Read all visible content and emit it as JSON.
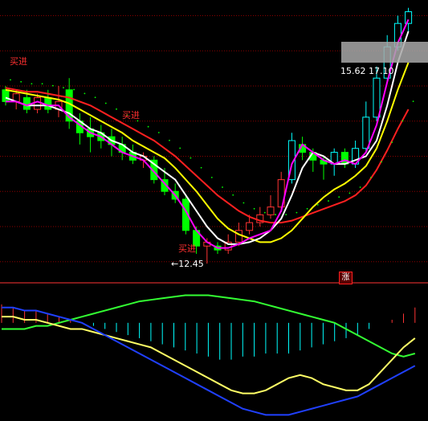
{
  "chart_data": {
    "type": "candlestick",
    "annotations": {
      "low_label": "←12.45",
      "price_label": "15.62  17.10",
      "signals": [
        "买进",
        "买进",
        "买进"
      ],
      "marker": "涨"
    },
    "colors": {
      "background": "#000000",
      "up": "#ff3333",
      "down": "#00ff00",
      "up_alt": "#00ffff",
      "ma_white": "#ffffff",
      "ma_yellow": "#ffff00",
      "ma_red": "#ff2020",
      "ma_magenta": "#ff00ff",
      "macd_dif": "#ffff66",
      "macd_dea": "#2040ff",
      "macd_slow": "#33ff33",
      "grid": "#8b0000"
    },
    "candles": [
      {
        "o": 16.9,
        "c": 16.6,
        "h": 17.0,
        "l": 16.5
      },
      {
        "o": 16.6,
        "c": 16.8,
        "h": 16.9,
        "l": 16.4
      },
      {
        "o": 16.7,
        "c": 16.4,
        "h": 16.9,
        "l": 16.3
      },
      {
        "o": 16.4,
        "c": 16.7,
        "h": 16.8,
        "l": 16.3
      },
      {
        "o": 16.7,
        "c": 16.4,
        "h": 16.9,
        "l": 16.3
      },
      {
        "o": 16.4,
        "c": 16.6,
        "h": 17.0,
        "l": 16.2
      },
      {
        "o": 16.9,
        "c": 16.1,
        "h": 17.2,
        "l": 15.9
      },
      {
        "o": 16.1,
        "c": 15.8,
        "h": 16.3,
        "l": 15.5
      },
      {
        "o": 15.9,
        "c": 15.7,
        "h": 16.2,
        "l": 15.3
      },
      {
        "o": 15.8,
        "c": 15.6,
        "h": 16.0,
        "l": 15.4
      },
      {
        "o": 15.7,
        "c": 15.5,
        "h": 15.9,
        "l": 15.2
      },
      {
        "o": 15.5,
        "c": 15.3,
        "h": 15.7,
        "l": 15.1
      },
      {
        "o": 15.3,
        "c": 15.1,
        "h": 15.5,
        "l": 15.0
      },
      {
        "o": 15.1,
        "c": 15.2,
        "h": 15.3,
        "l": 14.9
      },
      {
        "o": 15.1,
        "c": 14.6,
        "h": 15.2,
        "l": 14.5
      },
      {
        "o": 14.6,
        "c": 14.3,
        "h": 14.9,
        "l": 14.2
      },
      {
        "o": 14.3,
        "c": 14.1,
        "h": 14.5,
        "l": 14.0
      },
      {
        "o": 14.1,
        "c": 13.3,
        "h": 14.2,
        "l": 13.2
      },
      {
        "o": 13.3,
        "c": 12.9,
        "h": 13.4,
        "l": 12.7
      },
      {
        "o": 12.9,
        "c": 13.0,
        "h": 13.1,
        "l": 12.45
      },
      {
        "o": 12.9,
        "c": 12.8,
        "h": 13.0,
        "l": 12.7
      },
      {
        "o": 12.8,
        "c": 13.0,
        "h": 13.2,
        "l": 12.7
      },
      {
        "o": 13.0,
        "c": 13.3,
        "h": 13.5,
        "l": 12.9
      },
      {
        "o": 13.3,
        "c": 13.5,
        "h": 13.7,
        "l": 13.2
      },
      {
        "o": 13.5,
        "c": 13.7,
        "h": 13.9,
        "l": 13.4
      },
      {
        "o": 13.7,
        "c": 13.9,
        "h": 14.2,
        "l": 13.6
      },
      {
        "o": 13.9,
        "c": 14.6,
        "h": 14.8,
        "l": 13.8
      },
      {
        "o": 14.6,
        "c": 15.6,
        "h": 15.8,
        "l": 14.5
      },
      {
        "o": 15.5,
        "c": 15.3,
        "h": 15.7,
        "l": 15.1
      },
      {
        "o": 15.3,
        "c": 15.1,
        "h": 15.4,
        "l": 14.8
      },
      {
        "o": 15.1,
        "c": 15.0,
        "h": 15.2,
        "l": 14.6
      },
      {
        "o": 15.0,
        "c": 15.3,
        "h": 15.4,
        "l": 14.7
      },
      {
        "o": 15.3,
        "c": 15.0,
        "h": 15.4,
        "l": 14.9
      },
      {
        "o": 15.0,
        "c": 15.4,
        "h": 15.6,
        "l": 14.9
      },
      {
        "o": 15.4,
        "c": 16.2,
        "h": 16.6,
        "l": 15.3
      },
      {
        "o": 16.2,
        "c": 17.2,
        "h": 17.5,
        "l": 16.1
      },
      {
        "o": 17.2,
        "c": 18.0,
        "h": 18.3,
        "l": 17.1
      },
      {
        "o": 18.0,
        "c": 18.6,
        "h": 18.8,
        "l": 17.9
      },
      {
        "o": 18.6,
        "c": 18.9,
        "h": 19.0,
        "l": 18.4
      }
    ],
    "ma_white": [
      16.7,
      16.6,
      16.5,
      16.5,
      16.5,
      16.4,
      16.3,
      16.1,
      15.9,
      15.8,
      15.6,
      15.5,
      15.3,
      15.2,
      15.0,
      14.8,
      14.6,
      14.2,
      13.8,
      13.4,
      13.1,
      12.95,
      12.95,
      13.0,
      13.1,
      13.3,
      13.6,
      14.2,
      14.9,
      15.3,
      15.2,
      15.0,
      15.0,
      15.1,
      15.2,
      15.6,
      16.5,
      17.6,
      18.4
    ],
    "ma_magenta": [
      16.6,
      16.6,
      16.5,
      16.6,
      16.5,
      16.5,
      16.2,
      16.0,
      15.8,
      15.7,
      15.5,
      15.3,
      15.2,
      15.1,
      14.8,
      14.5,
      14.2,
      13.8,
      13.3,
      13.0,
      12.85,
      12.85,
      12.95,
      13.1,
      13.2,
      13.3,
      13.8,
      15.0,
      15.5,
      15.3,
      15.1,
      15.0,
      15.1,
      15.0,
      15.3,
      16.0,
      17.1,
      18.1,
      18.7
    ],
    "ma_yellow": [
      16.9,
      16.85,
      16.8,
      16.75,
      16.7,
      16.65,
      16.55,
      16.4,
      16.25,
      16.1,
      15.95,
      15.8,
      15.6,
      15.45,
      15.3,
      15.15,
      14.9,
      14.6,
      14.3,
      13.95,
      13.6,
      13.35,
      13.2,
      13.1,
      13.0,
      13.0,
      13.1,
      13.3,
      13.6,
      13.9,
      14.15,
      14.35,
      14.5,
      14.7,
      14.95,
      15.4,
      16.1,
      16.9,
      17.6
    ],
    "ma_red": [
      16.95,
      16.9,
      16.85,
      16.85,
      16.8,
      16.75,
      16.7,
      16.6,
      16.5,
      16.35,
      16.2,
      16.05,
      15.9,
      15.75,
      15.6,
      15.4,
      15.2,
      14.95,
      14.7,
      14.45,
      14.2,
      14.0,
      13.8,
      13.65,
      13.55,
      13.5,
      13.5,
      13.55,
      13.65,
      13.75,
      13.85,
      13.95,
      14.05,
      14.2,
      14.45,
      14.85,
      15.35,
      15.9,
      16.4
    ],
    "macd_hist": [
      0.06,
      0.05,
      0.04,
      0.04,
      0.03,
      0.02,
      0.01,
      0.0,
      -0.01,
      -0.02,
      -0.03,
      -0.04,
      -0.05,
      -0.06,
      -0.07,
      -0.08,
      -0.09,
      -0.1,
      -0.11,
      -0.12,
      -0.12,
      -0.11,
      -0.11,
      -0.1,
      -0.1,
      -0.1,
      -0.09,
      -0.08,
      -0.07,
      -0.06,
      -0.05,
      -0.04,
      -0.02,
      0.0,
      0.01,
      0.03,
      0.05
    ],
    "macd_dif": [
      0.02,
      0.02,
      0.01,
      0.01,
      0.0,
      -0.01,
      -0.02,
      -0.02,
      -0.03,
      -0.04,
      -0.05,
      -0.06,
      -0.07,
      -0.08,
      -0.1,
      -0.12,
      -0.14,
      -0.16,
      -0.18,
      -0.2,
      -0.22,
      -0.23,
      -0.23,
      -0.22,
      -0.2,
      -0.18,
      -0.17,
      -0.18,
      -0.2,
      -0.21,
      -0.22,
      -0.22,
      -0.2,
      -0.16,
      -0.12,
      -0.08,
      -0.05
    ],
    "macd_dea": [
      0.05,
      0.05,
      0.04,
      0.04,
      0.03,
      0.02,
      0.01,
      0.0,
      -0.02,
      -0.04,
      -0.06,
      -0.08,
      -0.1,
      -0.12,
      -0.14,
      -0.16,
      -0.18,
      -0.2,
      -0.22,
      -0.24,
      -0.26,
      -0.28,
      -0.29,
      -0.3,
      -0.3,
      -0.3,
      -0.29,
      -0.28,
      -0.27,
      -0.26,
      -0.25,
      -0.24,
      -0.22,
      -0.2,
      -0.18,
      -0.16,
      -0.14
    ],
    "macd_slow": [
      -0.02,
      -0.02,
      -0.02,
      -0.01,
      -0.01,
      0.0,
      0.01,
      0.02,
      0.03,
      0.04,
      0.05,
      0.06,
      0.07,
      0.075,
      0.08,
      0.085,
      0.09,
      0.09,
      0.09,
      0.085,
      0.08,
      0.075,
      0.07,
      0.06,
      0.05,
      0.04,
      0.03,
      0.02,
      0.01,
      0.0,
      -0.02,
      -0.04,
      -0.06,
      -0.08,
      -0.1,
      -0.11,
      -0.1
    ]
  }
}
